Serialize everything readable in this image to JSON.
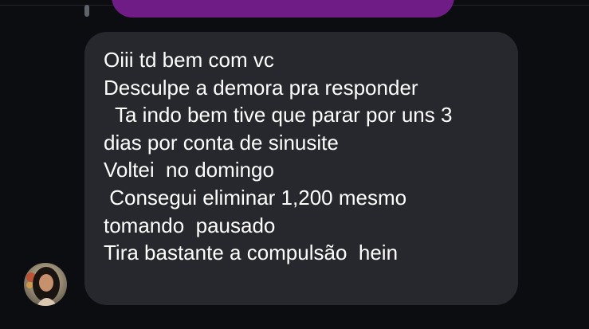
{
  "conversation": {
    "received_message": {
      "lines": [
        "Oiii td bem com vc",
        "Desculpe a demora pra responder",
        "  Ta indo bem tive que parar por uns 3",
        "dias por conta de sinusite",
        "Voltei  no domingo",
        " Consegui eliminar 1,200 mesmo",
        "tomando  pausado",
        "Tira bastante a compulsão  hein"
      ]
    }
  },
  "colors": {
    "background": "#0b0d11",
    "received_bubble": "#26282d",
    "sent_bubble": "#6f1c87",
    "text": "#ffffff"
  },
  "icons": {
    "avatar": "profile-photo"
  }
}
